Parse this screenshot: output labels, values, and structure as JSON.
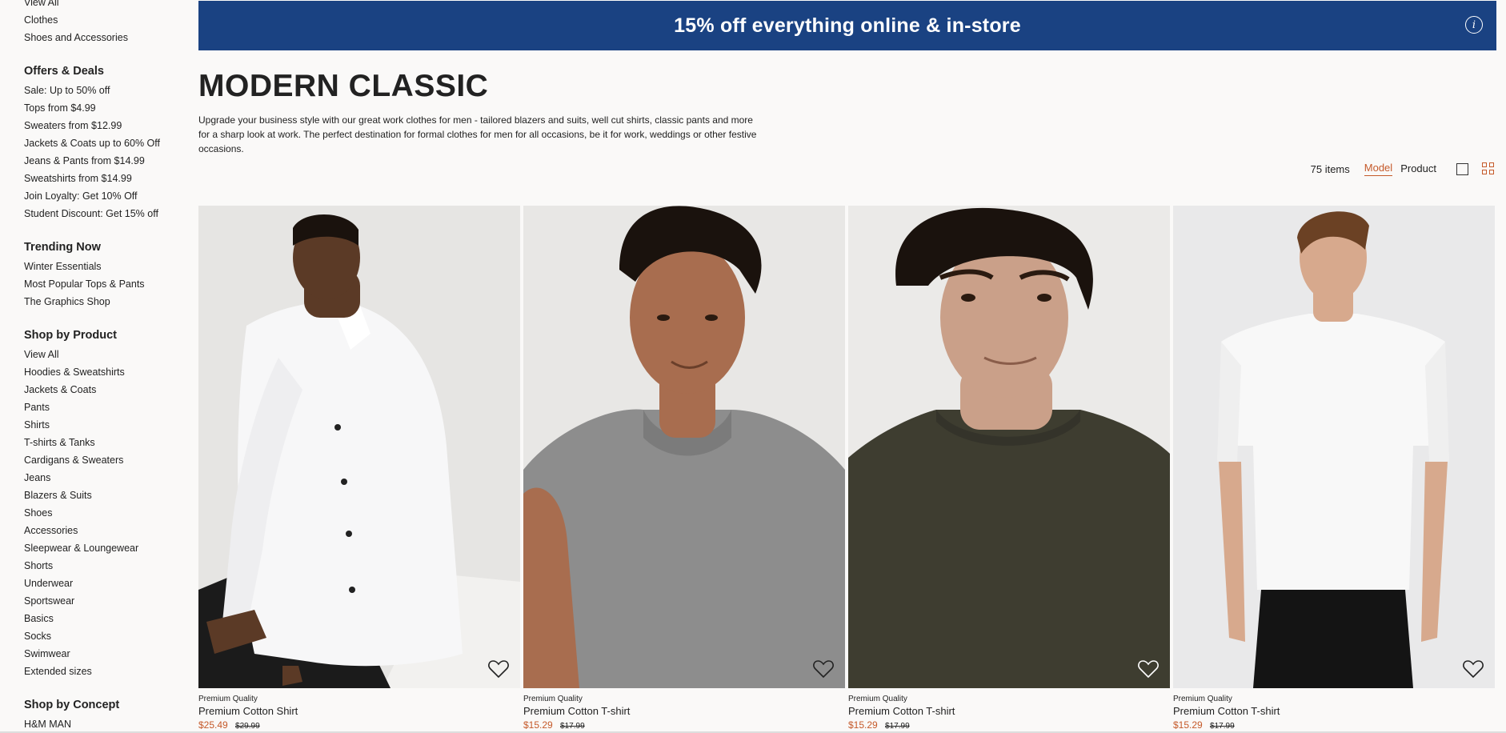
{
  "sidebar": {
    "top_links": [
      "View All",
      "Clothes",
      "Shoes and Accessories"
    ],
    "sections": [
      {
        "heading": "Offers & Deals",
        "items": [
          "Sale: Up to 50% off",
          "Tops from $4.99",
          "Sweaters from $12.99",
          "Jackets & Coats up to 60% Off",
          "Jeans & Pants from $14.99",
          "Sweatshirts from $14.99",
          "Join Loyalty: Get 10% Off",
          "Student Discount: Get 15% off"
        ]
      },
      {
        "heading": "Trending Now",
        "items": [
          "Winter Essentials",
          "Most Popular Tops & Pants",
          "The Graphics Shop"
        ]
      },
      {
        "heading": "Shop by Product",
        "items": [
          "View All",
          "Hoodies & Sweatshirts",
          "Jackets & Coats",
          "Pants",
          "Shirts",
          "T-shirts & Tanks",
          "Cardigans & Sweaters",
          "Jeans",
          "Blazers & Suits",
          "Shoes",
          "Accessories",
          "Sleepwear & Loungewear",
          "Shorts",
          "Underwear",
          "Sportswear",
          "Basics",
          "Socks",
          "Swimwear",
          "Extended sizes"
        ]
      },
      {
        "heading": "Shop by Concept",
        "items": [
          "H&M MAN"
        ]
      }
    ]
  },
  "banner": {
    "text": "15% off everything online & in-store",
    "info_icon": "i"
  },
  "page": {
    "title": "MODERN CLASSIC",
    "description": "Upgrade your business style with our great work clothes for men - tailored blazers and suits, well cut shirts, classic pants and more for a sharp look at work. The perfect destination for formal clothes for men for all occasions, be it for work, weddings or other festive occasions."
  },
  "toolbar": {
    "count": "75 items",
    "tab_model": "Model",
    "tab_product": "Product"
  },
  "products": [
    {
      "quality": "Premium Quality",
      "name": "Premium Cotton Shirt",
      "price": "$25.49",
      "orig_price": "$29.99"
    },
    {
      "quality": "Premium Quality",
      "name": "Premium Cotton T-shirt",
      "price": "$15.29",
      "orig_price": "$17.99"
    },
    {
      "quality": "Premium Quality",
      "name": "Premium Cotton T-shirt",
      "price": "$15.29",
      "orig_price": "$17.99"
    },
    {
      "quality": "Premium Quality",
      "name": "Premium Cotton T-shirt",
      "price": "$15.29",
      "orig_price": "$17.99"
    }
  ],
  "colors": {
    "banner": "#1a4282",
    "accent": "#c55a2a",
    "text": "#222222",
    "background": "#faf9f8"
  },
  "icons": [
    "info-icon",
    "single-view-icon",
    "grid-view-icon",
    "heart-icon"
  ]
}
